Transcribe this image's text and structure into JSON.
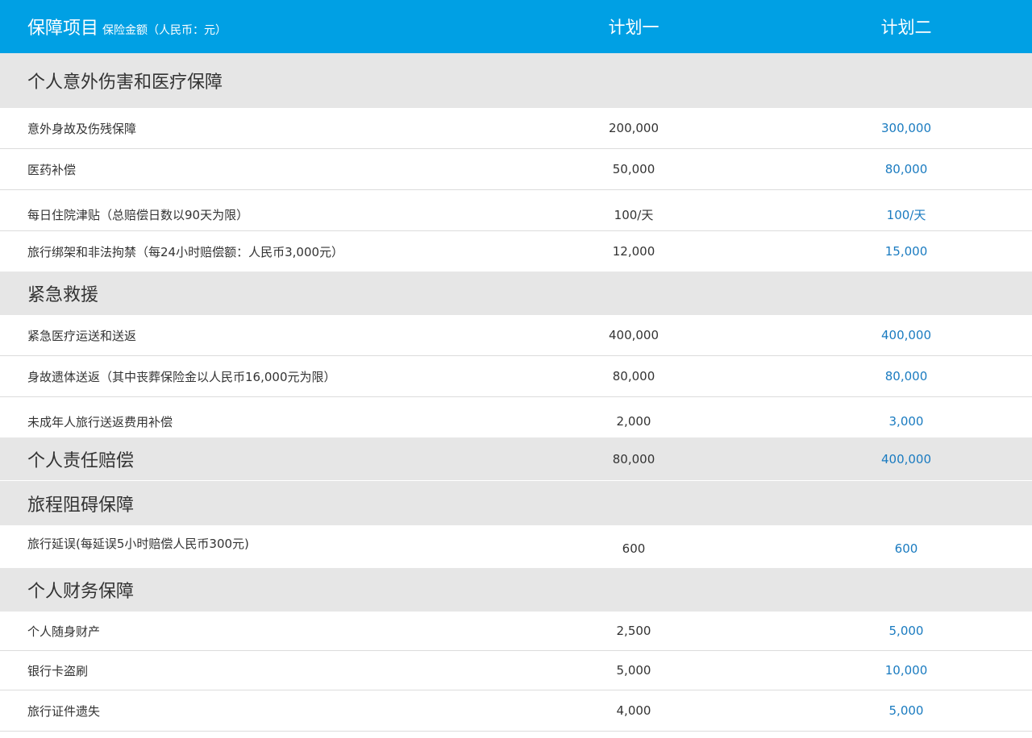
{
  "header": {
    "title": "保障项目",
    "subtitle": "保险金额（人民币：元）",
    "plan1": "计划一",
    "plan2": "计划二"
  },
  "rows": [
    {
      "kind": "section",
      "label": "个人意外伤害和医疗保障"
    },
    {
      "kind": "item",
      "label": "意外身故及伤残保障",
      "v1": "200,000",
      "v2": "300,000"
    },
    {
      "kind": "item",
      "label": "医药补偿",
      "v1": "50,000",
      "v2": "80,000"
    },
    {
      "kind": "item",
      "label": "每日住院津贴（总赔偿日数以90天为限）",
      "v1": "100/天",
      "v2": "100/天"
    },
    {
      "kind": "item",
      "label": "旅行绑架和非法拘禁（每24小时赔偿额：人民币3,000元）",
      "v1": "12,000",
      "v2": "15,000"
    },
    {
      "kind": "section",
      "label": "紧急救援"
    },
    {
      "kind": "item",
      "label": "紧急医疗运送和送返",
      "v1": "400,000",
      "v2": "400,000"
    },
    {
      "kind": "item",
      "label": "身故遗体送返（其中丧葬保险金以人民币16,000元为限）",
      "v1": "80,000",
      "v2": "80,000"
    },
    {
      "kind": "item",
      "label": "未成年人旅行送返费用补偿",
      "v1": "2,000",
      "v2": "3,000"
    },
    {
      "kind": "section",
      "label": "个人责任赔偿",
      "v1": "80,000",
      "v2": "400,000"
    },
    {
      "kind": "section",
      "label": "旅程阻碍保障"
    },
    {
      "kind": "item",
      "label": "旅行延误(每延误5小时赔偿人民币300元)",
      "v1": "600",
      "v2": "600"
    },
    {
      "kind": "section",
      "label": "个人财务保障"
    },
    {
      "kind": "item",
      "label": "个人随身财产",
      "v1": "2,500",
      "v2": "5,000"
    },
    {
      "kind": "item",
      "label": "银行卡盗刷",
      "v1": "5,000",
      "v2": "10,000"
    },
    {
      "kind": "item",
      "label": "旅行证件遗失",
      "v1": "4,000",
      "v2": "5,000"
    }
  ]
}
